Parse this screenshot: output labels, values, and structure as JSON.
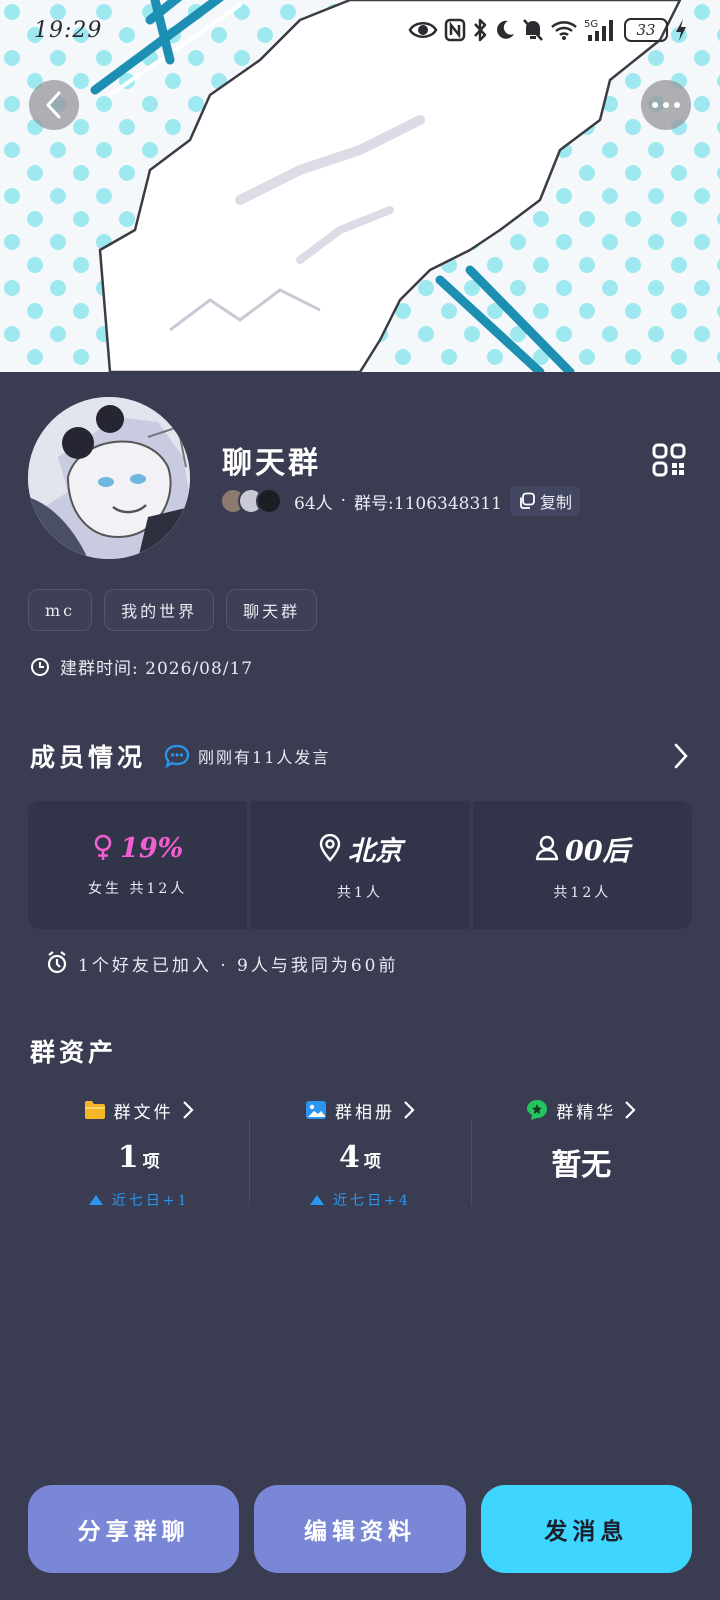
{
  "status_bar": {
    "time": "19:29",
    "network": "5G",
    "battery": "33"
  },
  "profile": {
    "group_name": "聊天群",
    "member_count": "64人",
    "separator": "·",
    "group_number": "群号:1106348311",
    "copy_label": "复制",
    "tags": [
      "mc",
      "我的世界",
      "聊天群"
    ],
    "created": "建群时间: 2026/08/17"
  },
  "members": {
    "title": "成员情况",
    "recent": "刚刚有11人发言",
    "stats": [
      {
        "icon": "female-icon",
        "value": "19%",
        "sub": "女生 共12人"
      },
      {
        "icon": "location-pin-icon",
        "value": "北京",
        "sub": "共1人"
      },
      {
        "icon": "person-icon",
        "value": "00后",
        "sub": "共12人"
      }
    ],
    "friends": "1个好友已加入 · 9人与我同为60前"
  },
  "assets": {
    "title": "群资产",
    "items": [
      {
        "icon": "folder-icon",
        "label": "群文件",
        "count": "1",
        "unit": "项",
        "trend": "近七日+1",
        "color": "#f5b72a"
      },
      {
        "icon": "photo-icon",
        "label": "群相册",
        "count": "4",
        "unit": "项",
        "trend": "近七日+4",
        "color": "#2a96f0"
      },
      {
        "icon": "star-badge-icon",
        "label": "群精华",
        "count": "暂无",
        "unit": "",
        "trend": "",
        "color": "#22c55e"
      }
    ]
  },
  "actions": {
    "share": "分享群聊",
    "edit": "编辑资料",
    "send": "发消息"
  },
  "colors": {
    "background": "#3a3d52",
    "card": "#32354a",
    "accent_cyan": "#3ed6ff",
    "button_secondary": "#7a86d6",
    "pink": "#f25fd0",
    "trend_blue": "#2a96f0"
  }
}
